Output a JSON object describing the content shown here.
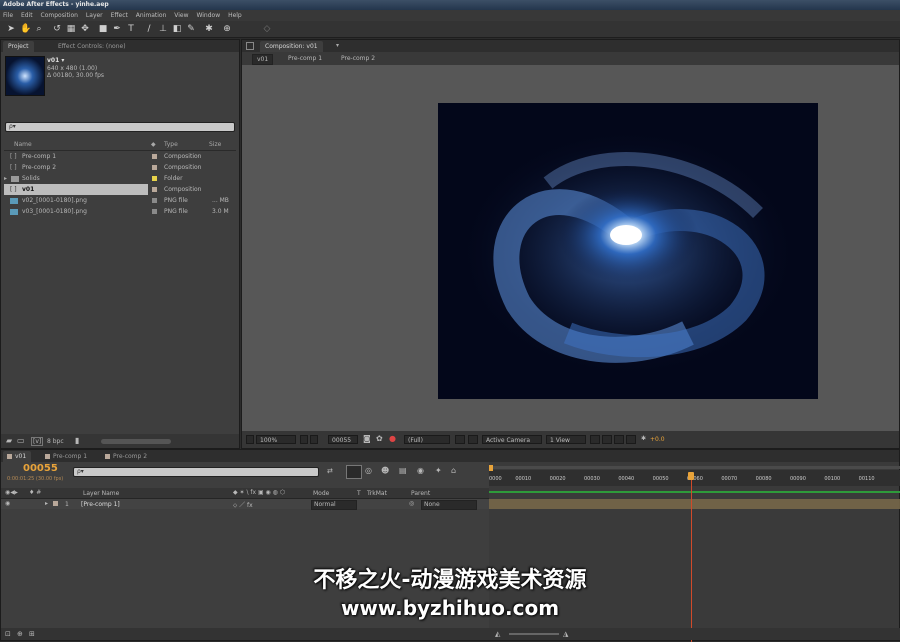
{
  "window": {
    "title": "Adobe After Effects - yinhe.aep"
  },
  "menu": [
    "File",
    "Edit",
    "Composition",
    "Layer",
    "Effect",
    "Animation",
    "View",
    "Window",
    "Help"
  ],
  "project_panel": {
    "tabs": [
      "Project",
      "Effect Controls: (none)"
    ],
    "preview": {
      "name": "v01 ▾",
      "dims": "640 x 480 (1.00)",
      "duration": "Δ 00180, 30.00 fps"
    },
    "search_placeholder": "ρ▾",
    "columns": [
      "Name",
      "Type",
      "Size"
    ],
    "items": [
      {
        "name": "Pre-comp 1",
        "type": "Composition",
        "size": "",
        "color": "#b9a89a"
      },
      {
        "name": "Pre-comp 2",
        "type": "Composition",
        "size": "",
        "color": "#b9a89a"
      },
      {
        "name": "Solids",
        "type": "Folder",
        "size": "",
        "color": "#e8d34a"
      },
      {
        "name": "v01",
        "type": "Composition",
        "size": "",
        "color": "#b9a89a"
      },
      {
        "name": "v02_[0001-0180].png",
        "type": "PNG file",
        "size": "... MB",
        "color": "#8a8a8a"
      },
      {
        "name": "v03_[0001-0180].png",
        "type": "PNG file",
        "size": "3.0 M",
        "color": "#8a8a8a"
      }
    ],
    "bpc": "8 bpc"
  },
  "comp_viewer": {
    "tab": "Composition: v01",
    "crumbs": [
      "v01",
      "Pre-comp 1",
      "Pre-comp 2"
    ],
    "zoom": "100%",
    "timecode": "00055",
    "resolution": "(Full)",
    "camera": "Active Camera",
    "views": "1 View",
    "exposure": "+0.0"
  },
  "timeline": {
    "tabs": [
      "v01",
      "Pre-comp 1",
      "Pre-comp 2"
    ],
    "current_time": "00055",
    "time_sub": "0:00:01:25 (30.00 fps)",
    "search_placeholder": "ρ▾",
    "columns": {
      "layer_name": "Layer Name",
      "mode": "Mode",
      "t": "T",
      "trkmat": "TrkMat",
      "parent": "Parent"
    },
    "layers": [
      {
        "num": "1",
        "name": "[Pre-comp 1]",
        "mode": "Normal",
        "parent": "None"
      }
    ],
    "ticks": [
      "0000",
      "00010",
      "00020",
      "00030",
      "00040",
      "00050",
      "00060",
      "00070",
      "00080",
      "00090",
      "00100",
      "00110"
    ],
    "playhead_fraction": 0.49
  },
  "watermark": {
    "line1": "不移之火-动漫游戏美术资源",
    "line2": "www.byzhihuo.com"
  },
  "colors": {
    "accent": "#e8a33a",
    "playhead": "#d04a2a",
    "layer_bar": "#7a6a4a"
  }
}
